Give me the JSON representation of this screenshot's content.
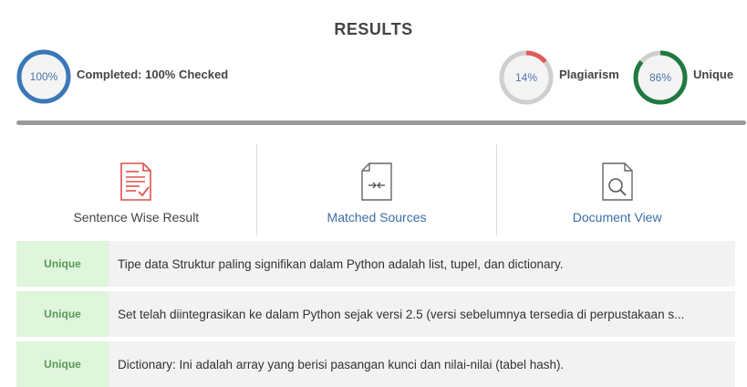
{
  "header": {
    "title": "RESULTS"
  },
  "completed": {
    "percent_label": "100%",
    "percent": 100,
    "label": "Completed: 100% Checked",
    "color": "#3a78b8"
  },
  "plagiarism": {
    "percent_label": "14%",
    "percent": 14,
    "label": "Plagiarism",
    "color": "#e05a5a",
    "track": "#cfcfcf"
  },
  "unique": {
    "percent_label": "86%",
    "percent": 86,
    "label": "Unique",
    "color": "#1f7a3f",
    "track": "#cfcfcf"
  },
  "tabs": [
    {
      "label": "Sentence Wise Result",
      "icon": "document-report-icon",
      "active": true
    },
    {
      "label": "Matched Sources",
      "icon": "compare-file-icon",
      "active": false
    },
    {
      "label": "Document View",
      "icon": "search-document-icon",
      "active": false
    }
  ],
  "results": [
    {
      "status": "Unique",
      "text": "Tipe data Struktur paling signifikan dalam Python adalah list, tupel, dan dictionary."
    },
    {
      "status": "Unique",
      "text": "Set telah diintegrasikan ke dalam Python sejak versi 2.5 (versi sebelumnya tersedia di perpustakaan s..."
    },
    {
      "status": "Unique",
      "text": "Dictionary: Ini adalah array yang berisi pasangan kunci dan nilai-nilai (tabel hash)."
    }
  ]
}
